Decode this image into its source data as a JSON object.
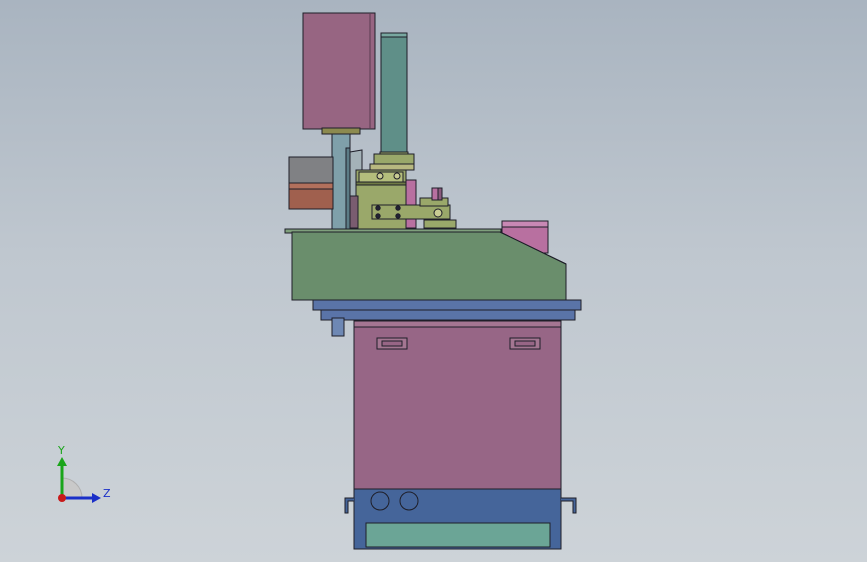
{
  "viewport": {
    "background_top": "#a9b4c0",
    "background_bottom": "#cdd3d8"
  },
  "model": {
    "colors": {
      "motor_housing": "#976582",
      "cylinder_column": "#5f8f88",
      "bracket_olive": "#9aa86a",
      "base_table": "#6a8e6c",
      "cabinet_body": "#976686",
      "cabinet_base": "#45659a",
      "plate_blue": "#5a74a8",
      "panel_teal": "#6ba596",
      "counterweight_gray": "#808184",
      "counterweight_rust": "#a0604e",
      "accent_magenta": "#b870a0"
    }
  },
  "triad": {
    "y_label": "Y",
    "z_label": "Z",
    "icon": "coordinate-triad-icon",
    "y_color": "#1aa51a",
    "z_color": "#1a2fc8",
    "origin_color": "#c81a1a"
  }
}
